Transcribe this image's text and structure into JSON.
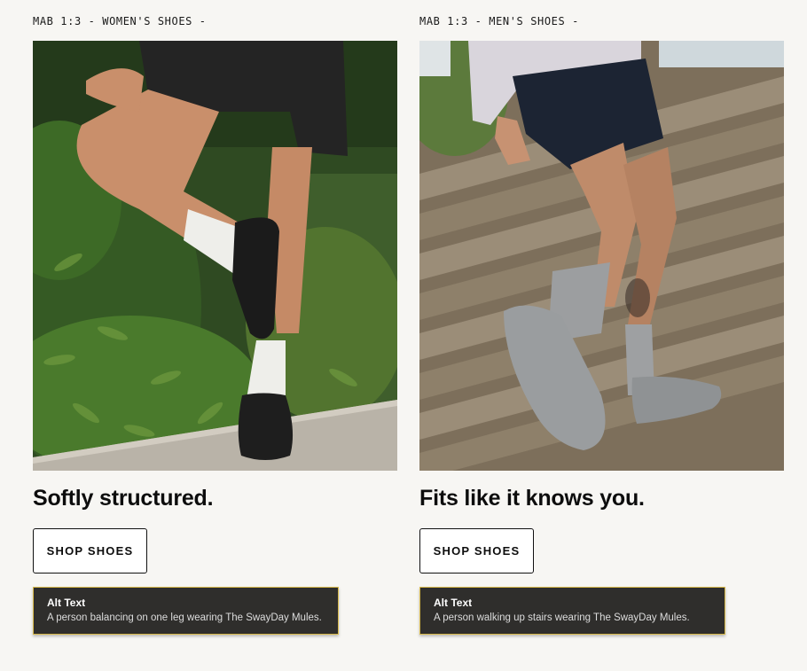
{
  "columns": [
    {
      "eyebrow": "MAB 1:3 - WOMEN'S SHOES -",
      "headline": "Softly structured.",
      "cta_label": "SHOP SHOES",
      "alt_title": "Alt Text",
      "alt_text": "A person balancing on one leg wearing The SwayDay Mules."
    },
    {
      "eyebrow": "MAB 1:3 - MEN'S SHOES -",
      "headline": "Fits like it knows you.",
      "cta_label": "SHOP SHOES",
      "alt_title": "Alt Text",
      "alt_text": "A person walking up stairs wearing The SwayDay Mules."
    }
  ],
  "colors": {
    "background": "#f7f6f3",
    "alt_box": "#2f2e2c",
    "alt_border": "#d7b94a",
    "text": "#0d0d0d"
  }
}
